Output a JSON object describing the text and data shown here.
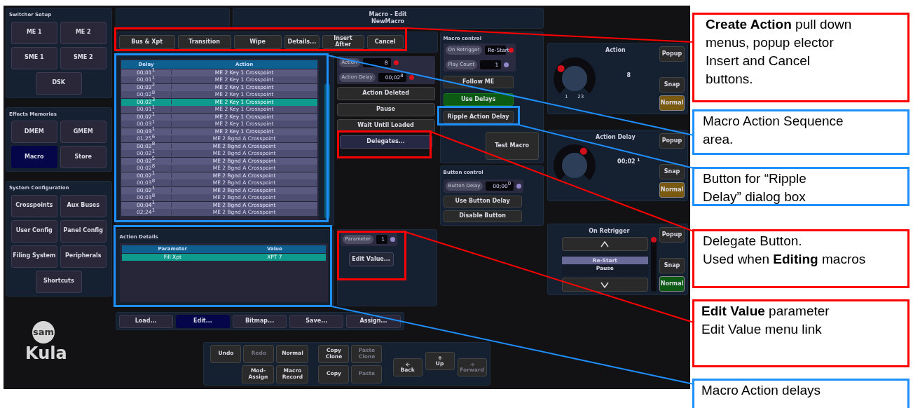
{
  "sidebar": [
    {
      "title": "Switcher Setup",
      "buttons": [
        {
          "label": "ME 1",
          "selected": false
        },
        {
          "label": "ME 2",
          "selected": false
        },
        {
          "label": "SME 1",
          "selected": false
        },
        {
          "label": "SME 2",
          "selected": false
        },
        {
          "label": "DSK",
          "selected": false
        }
      ]
    },
    {
      "title": "Effects Memories",
      "buttons": [
        {
          "label": "DMEM",
          "selected": false
        },
        {
          "label": "GMEM",
          "selected": false
        },
        {
          "label": "Macro",
          "selected": true
        },
        {
          "label": "Store",
          "selected": false
        }
      ]
    },
    {
      "title": "System Configuration",
      "buttons": [
        {
          "label": "Crosspoints",
          "selected": false
        },
        {
          "label": "Aux Buses",
          "selected": false
        },
        {
          "label": "User Config",
          "selected": false
        },
        {
          "label": "Panel Config",
          "selected": false
        },
        {
          "label": "Filing System",
          "selected": false
        },
        {
          "label": "Peripherals",
          "selected": false
        },
        {
          "label": "Shortcuts",
          "selected": false
        }
      ]
    }
  ],
  "logo": {
    "badge": "sam",
    "name": "Kula"
  },
  "title": {
    "line1": "Macro - Edit",
    "line2": "NewMacro"
  },
  "toolbar": [
    "Bus & Xpt",
    "Transition",
    "Wipe",
    "Details...",
    "Insert After",
    "Cancel"
  ],
  "macro_actions": {
    "columns": [
      "Delay",
      "Action"
    ],
    "rows": [
      {
        "delay": "00;01$^{1}$",
        "action": "ME 2 Key 1 Crosspoint",
        "selected": false
      },
      {
        "delay": "00;01$^{1}$",
        "action": "ME 2 Key 1 Crosspoint",
        "selected": false
      },
      {
        "delay": "00;02$^{2}$",
        "action": "ME 2 Key 1 Crosspoint",
        "selected": false
      },
      {
        "delay": "00;02$^{8}$",
        "action": "ME 2 Key 1 Crosspoint",
        "selected": false
      },
      {
        "delay": "00;02$^{3}$",
        "action": "ME 2 Key 1 Crosspoint",
        "selected": true
      },
      {
        "delay": "00;01$^{1}$",
        "action": "ME 2 Key 1 Crosspoint",
        "selected": false
      },
      {
        "delay": "00;02$^{1}$",
        "action": "ME 2 Key 1 Crosspoint",
        "selected": false
      },
      {
        "delay": "00;03$^{1}$",
        "action": "ME 2 Key 1 Crosspoint",
        "selected": false
      },
      {
        "delay": "00;03$^{1}$",
        "action": "ME 2 Key 1 Crosspoint",
        "selected": false
      },
      {
        "delay": "01;25$^{6}$",
        "action": "ME 2 Bgnd A Crosspoint",
        "selected": false
      },
      {
        "delay": "00;02$^{8}$",
        "action": "ME 2 Bgnd A Crosspoint",
        "selected": false
      },
      {
        "delay": "00;02$^{1}$",
        "action": "ME 2 Bgnd A Crosspoint",
        "selected": false
      },
      {
        "delay": "00;02$^{5}$",
        "action": "ME 2 Bgnd A Crosspoint",
        "selected": false
      },
      {
        "delay": "00;02$^{8}$",
        "action": "ME 2 Bgnd A Crosspoint",
        "selected": false
      },
      {
        "delay": "00;02$^{1}$",
        "action": "ME 2 Bgnd A Crosspoint",
        "selected": false
      },
      {
        "delay": "00;03$^{8}$",
        "action": "ME 2 Bgnd A Crosspoint",
        "selected": false
      },
      {
        "delay": "00;02$^{1}$",
        "action": "ME 2 Bgnd A Crosspoint",
        "selected": false
      },
      {
        "delay": "00;03$^{8}$",
        "action": "ME 2 Bgnd A Crosspoint",
        "selected": false
      },
      {
        "delay": "00;04$^{1}$",
        "action": "ME 2 Bgnd A Crosspoint",
        "selected": false
      },
      {
        "delay": "02;24$^{1}$",
        "action": "ME 2 Bgnd A Crosspoint",
        "selected": false
      }
    ]
  },
  "action_fields": [
    {
      "label": "Action",
      "value": "8",
      "color": "#e0101c"
    },
    {
      "label": "Action Delay",
      "value": "00;02$^{8}$",
      "color": "#e0101c"
    }
  ],
  "action_buttons": [
    {
      "label": "Action Deleted",
      "kind": "plain"
    },
    {
      "label": "Pause",
      "kind": "plain"
    },
    {
      "label": "Wait Until Loaded",
      "kind": "plain"
    },
    {
      "label": "Delegates...",
      "kind": "menu"
    }
  ],
  "macro_control": {
    "title": "Macro control",
    "fields": [
      {
        "label": "On Retrigger",
        "value": "Re-Start",
        "color": "#e0101c"
      },
      {
        "label": "Play Count",
        "value": "1",
        "color": "#9088c8"
      }
    ],
    "buttons": [
      {
        "label": "Follow ME",
        "on": false
      },
      {
        "label": "Use Delays",
        "on": true
      },
      {
        "label": "Ripple Action Delay",
        "on": false
      }
    ],
    "test": "Test Macro"
  },
  "button_control": {
    "title": "Button control",
    "field": {
      "label": "Button Delay",
      "value": "00;00$^{0}$",
      "color": "#9088c8"
    },
    "buttons": [
      "Use Button Delay",
      "Disable Button"
    ]
  },
  "action_details": {
    "title": "Action Details",
    "columns": [
      "Parameter",
      "Value"
    ],
    "rows": [
      {
        "parameter": "Fill Xpt",
        "value": "XPT 7",
        "selected": true
      }
    ]
  },
  "parameter": {
    "label": "Parameter",
    "value": "1",
    "color": "#9088c8"
  },
  "edit_value": "Edit Value...",
  "file_buttons": [
    {
      "label": "Load...",
      "selected": false
    },
    {
      "label": "Edit...",
      "selected": true
    },
    {
      "label": "Bitmap...",
      "selected": false
    },
    {
      "label": "Save...",
      "selected": false
    },
    {
      "label": "Assign...",
      "selected": false
    }
  ],
  "edit_buttons": [
    {
      "label": "Undo",
      "disabled": false
    },
    {
      "label": "Redo",
      "disabled": true
    },
    {
      "label": "Normal",
      "disabled": false
    },
    {
      "label": "Mod-Assign",
      "disabled": false
    },
    {
      "label": "Macro Record",
      "disabled": false
    }
  ],
  "clone_buttons": [
    {
      "label": "Copy Clone",
      "disabled": false
    },
    {
      "label": "Paste Clone",
      "disabled": true
    },
    {
      "label": "Copy",
      "disabled": false
    },
    {
      "label": "Paste",
      "disabled": true
    }
  ],
  "nav_buttons": [
    {
      "label": "Back",
      "kind": "back",
      "disabled": false
    },
    {
      "label": "Up",
      "kind": "up",
      "disabled": false
    },
    {
      "label": "Forward",
      "kind": "forward",
      "disabled": true
    }
  ],
  "knobs": [
    {
      "title": "Action",
      "value": "8",
      "min": "1",
      "max": "23",
      "popup": "Popup",
      "snap": "Snap",
      "mode": "Normal",
      "color": "#7a5a10"
    },
    {
      "title": "Action Delay",
      "value": "00;02 $^{1}$",
      "popup": "Popup",
      "snap": "Snap",
      "mode": "Normal",
      "color": "#7a5a10"
    }
  ],
  "retrigger": {
    "title": "On Retrigger",
    "options": [
      {
        "label": "Re-Start",
        "selected": true
      },
      {
        "label": "Pause",
        "selected": false
      }
    ],
    "popup": "Popup",
    "snap": "Snap",
    "mode": "Normal",
    "color": "#0d5a14"
  },
  "annotations": [
    {
      "text": "**Create Action** pull down\nmenus, popup elector\nInsert and Cancel\nbuttons.",
      "color": "#ff0000"
    },
    {
      "text": "Macro Action Sequence\narea.",
      "color": "#1e8fff"
    },
    {
      "text": "Button for “Ripple\nDelay” dialog box",
      "color": "#1e8fff"
    },
    {
      "text": "Delegate Button.\nUsed when **Editing** macros",
      "color": "#ff0000"
    },
    {
      "text": "**Edit Value** parameter\nEdit Value menu link",
      "color": "#ff0000"
    },
    {
      "text": "Macro Action delays",
      "color": "#1e8fff"
    }
  ]
}
